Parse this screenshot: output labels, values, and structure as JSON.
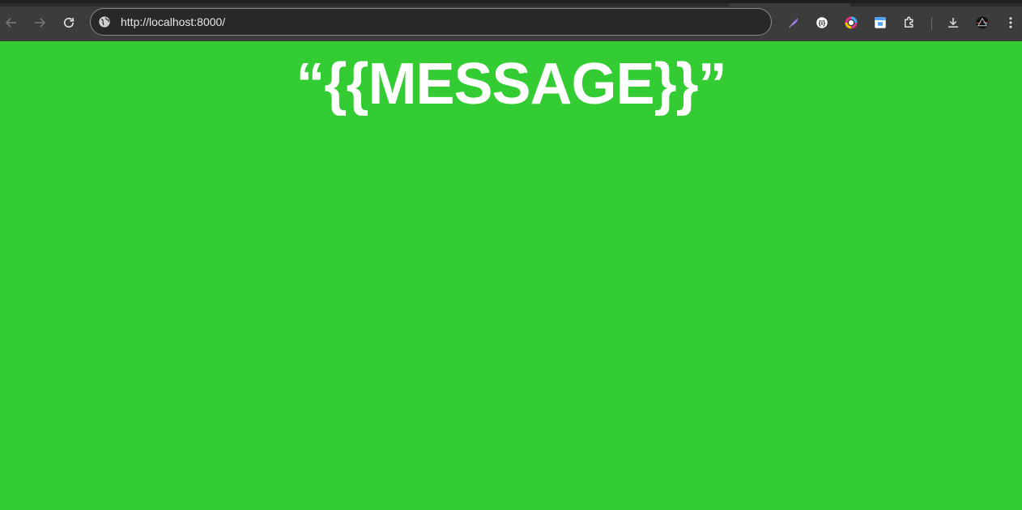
{
  "browser": {
    "url": "http://localhost:8000/",
    "toolbar_color": "#3c3c3c",
    "icons": {
      "back": "arrow-left-icon",
      "forward": "arrow-right-icon",
      "reload": "reload-icon",
      "site_info": "globe-icon",
      "extensions": [
        "feather-extension-icon",
        "info-extension-icon",
        "color-picker-extension-icon",
        "screenshot-extension-icon",
        "puzzle-icon"
      ],
      "downloads": "download-icon",
      "profile": "avatar",
      "menu": "kebab-menu-icon"
    }
  },
  "page": {
    "background_color": "#33cc33",
    "message": "“{{MESSAGE}}”"
  }
}
